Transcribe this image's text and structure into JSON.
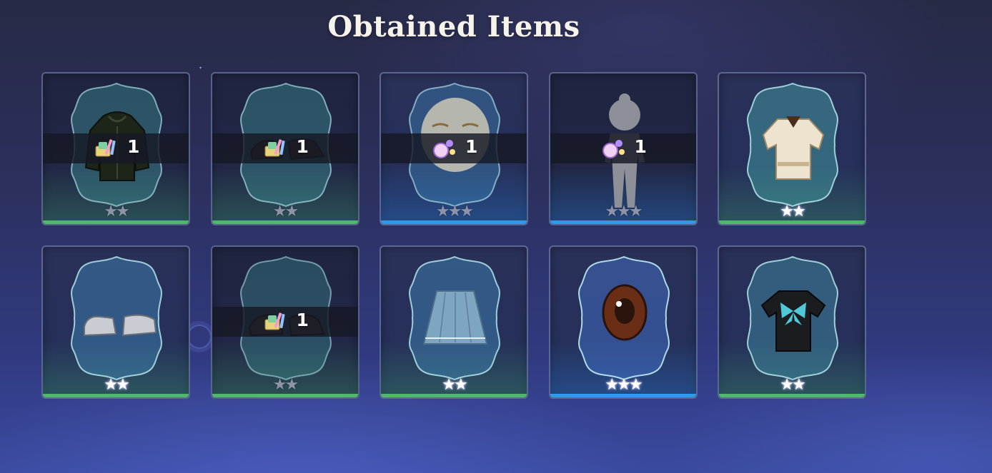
{
  "title": "Obtained Items",
  "colors": {
    "rarity_2": "#4fb86d",
    "rarity_3": "#2f9be8",
    "qty_band": "#16182499"
  },
  "items": [
    {
      "name_icon": "dark-hoodie-icon",
      "rarity": 2,
      "stars_lit": false,
      "quantity": "1",
      "qty_icon": "outfit-dye-kit-icon",
      "dim": true
    },
    {
      "name_icon": "dark-boots-icon",
      "rarity": 2,
      "stars_lit": false,
      "quantity": "1",
      "qty_icon": "outfit-dye-kit-icon",
      "dim": true
    },
    {
      "name_icon": "face-makeup-icon",
      "rarity": 3,
      "stars_lit": false,
      "quantity": "1",
      "qty_icon": "makeup-palette-icon",
      "dim": false
    },
    {
      "name_icon": "body-silhouette-icon",
      "rarity": 3,
      "stars_lit": false,
      "quantity": "1",
      "qty_icon": "makeup-palette-icon",
      "dim": true
    },
    {
      "name_icon": "cream-jacket-icon",
      "rarity": 2,
      "stars_lit": true,
      "quantity": null,
      "dim": false
    },
    {
      "name_icon": "gray-sandals-icon",
      "rarity": 2,
      "stars_lit": true,
      "quantity": null,
      "dim": false
    },
    {
      "name_icon": "dark-sneakers-icon",
      "rarity": 2,
      "stars_lit": false,
      "quantity": "1",
      "qty_icon": "outfit-dye-kit-icon",
      "dim": true
    },
    {
      "name_icon": "blue-pleated-skirt-icon",
      "rarity": 2,
      "stars_lit": true,
      "quantity": null,
      "dim": false
    },
    {
      "name_icon": "brown-eye-icon",
      "rarity": 3,
      "stars_lit": true,
      "quantity": null,
      "dim": false
    },
    {
      "name_icon": "butterfly-tshirt-icon",
      "rarity": 2,
      "stars_lit": true,
      "quantity": null,
      "dim": false
    }
  ]
}
